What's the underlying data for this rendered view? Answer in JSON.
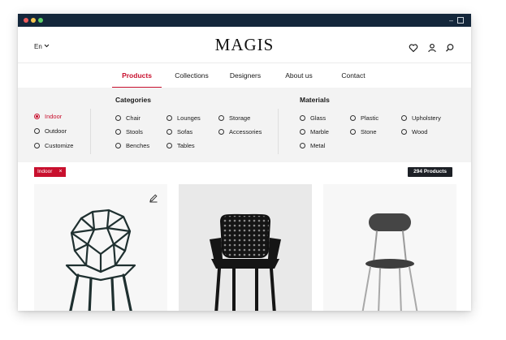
{
  "header": {
    "language": "En",
    "logo": "MAGIS",
    "icons": [
      "heart-icon",
      "user-icon",
      "search-icon"
    ]
  },
  "nav": {
    "items": [
      {
        "label": "Products",
        "active": true
      },
      {
        "label": "Collections",
        "active": false
      },
      {
        "label": "Designers",
        "active": false
      },
      {
        "label": "About us",
        "active": false
      },
      {
        "label": "Contact",
        "active": false
      }
    ]
  },
  "filters": {
    "environment": [
      {
        "label": "Indoor",
        "selected": true
      },
      {
        "label": "Outdoor",
        "selected": false
      },
      {
        "label": "Customize",
        "selected": false
      }
    ],
    "categories_title": "Categories",
    "categories": [
      "Chair",
      "Lounges",
      "Storage",
      "Stools",
      "Sofas",
      "Accessories",
      "Benches",
      "Tables"
    ],
    "materials_title": "Materials",
    "materials": [
      "Glass",
      "Plastic",
      "Upholstery",
      "Marble",
      "Stone",
      "Wood",
      "Metal"
    ]
  },
  "active_filter": {
    "label": "Indoor",
    "remove": "×"
  },
  "results": {
    "count_label": "294 Products"
  },
  "colors": {
    "accent": "#c8102e",
    "dark": "#1d2026",
    "titlebar": "#14273b"
  }
}
